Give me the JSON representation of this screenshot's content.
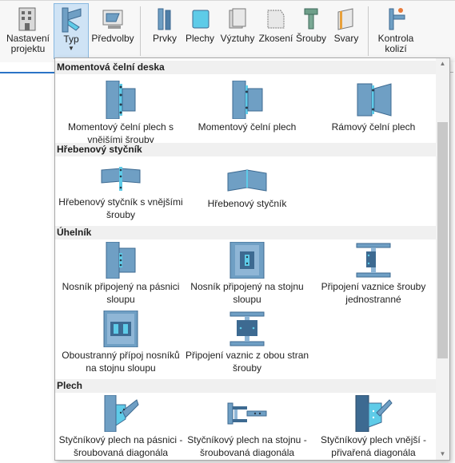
{
  "ribbon": {
    "buttons": [
      {
        "id": "nastaveni",
        "label": "Nastavení\nprojektu",
        "icon": "building-icon"
      },
      {
        "id": "typ",
        "label": "Typ",
        "icon": "connection-type-icon",
        "active": true
      },
      {
        "id": "predvolby",
        "label": "Předvolby",
        "icon": "presets-icon"
      },
      {
        "id": "prvky",
        "label": "Prvky",
        "icon": "members-icon"
      },
      {
        "id": "plechy",
        "label": "Plechy",
        "icon": "plates-icon"
      },
      {
        "id": "vyztuhy",
        "label": "Výztuhy",
        "icon": "stiffeners-icon"
      },
      {
        "id": "zkoseni",
        "label": "Zkosení",
        "icon": "chamfer-icon"
      },
      {
        "id": "srouby",
        "label": "Šrouby",
        "icon": "bolt-icon"
      },
      {
        "id": "svary",
        "label": "Svary",
        "icon": "welds-icon"
      },
      {
        "id": "kontrola",
        "label": "Kontrola\nkolizí",
        "icon": "collision-check-icon"
      }
    ]
  },
  "dropdown": {
    "sections": [
      {
        "title": "Momentová čelní deska",
        "items": [
          {
            "label": "Momentový čelní plech s vnějšími šrouby"
          },
          {
            "label": "Momentový čelní plech"
          },
          {
            "label": "Rámový čelní plech"
          }
        ]
      },
      {
        "title": "Hřebenový styčník",
        "items": [
          {
            "label": "Hřebenový styčník s vnějšími šrouby"
          },
          {
            "label": "Hřebenový styčník"
          }
        ]
      },
      {
        "title": "Úhelník",
        "items": [
          {
            "label": "Nosník připojený na pásnici sloupu"
          },
          {
            "label": "Nosník připojený na stojnu sloupu"
          },
          {
            "label": "Připojení vaznice šrouby jednostranné"
          },
          {
            "label": "Oboustranný přípoj nosníků na stojnu sloupu"
          },
          {
            "label": "Připojení vaznic z obou stran šrouby"
          }
        ]
      },
      {
        "title": "Plech",
        "items": [
          {
            "label": "Styčníkový plech na pásnici - šroubovaná diagonála"
          },
          {
            "label": "Styčníkový plech na stojnu - šroubovaná diagonála"
          },
          {
            "label": "Styčníkový plech vnější - přivařená diagonála"
          }
        ]
      }
    ]
  },
  "colors": {
    "steel": "#6f9fc4",
    "steel_dark": "#3d6a91",
    "plate": "#5ecbe8",
    "accent": "#2b74c7",
    "bolt": "#2a3a4a"
  }
}
